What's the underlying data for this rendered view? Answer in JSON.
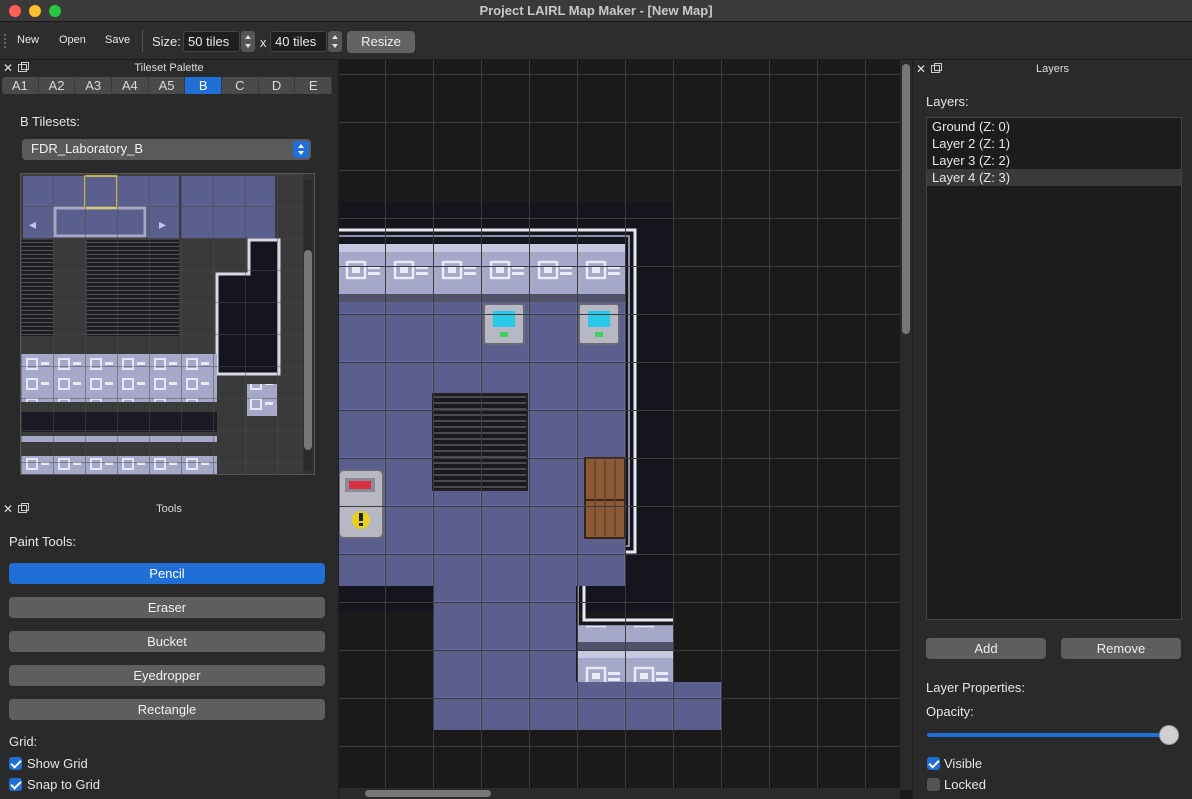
{
  "window": {
    "title": "Project LAIRL Map Maker - [New Map]"
  },
  "toolbar": {
    "new_label": "New",
    "open_label": "Open",
    "save_label": "Save",
    "size_label": "Size:",
    "width_value": "50 tiles",
    "x_label": "x",
    "height_value": "40 tiles",
    "resize_label": "Resize"
  },
  "tileset_palette": {
    "title": "Tileset Palette",
    "tabs": [
      {
        "label": "A1"
      },
      {
        "label": "A2"
      },
      {
        "label": "A3"
      },
      {
        "label": "A4"
      },
      {
        "label": "A5"
      },
      {
        "label": "B"
      },
      {
        "label": "C"
      },
      {
        "label": "D"
      },
      {
        "label": "E"
      }
    ],
    "active_tab": "B",
    "tilesets_label": "B Tilesets:",
    "selected_tileset": "FDR_Laboratory_B"
  },
  "tools": {
    "title": "Tools",
    "paint_label": "Paint Tools:",
    "buttons": [
      {
        "label": "Pencil"
      },
      {
        "label": "Eraser"
      },
      {
        "label": "Bucket"
      },
      {
        "label": "Eyedropper"
      },
      {
        "label": "Rectangle"
      }
    ],
    "active_tool": "Pencil",
    "grid_label": "Grid:",
    "show_grid_label": "Show Grid",
    "show_grid": true,
    "snap_label": "Snap to Grid",
    "snap": true
  },
  "layers": {
    "title": "Layers",
    "list_label": "Layers:",
    "items": [
      {
        "label": "Ground (Z: 0)"
      },
      {
        "label": "Layer 2 (Z: 1)"
      },
      {
        "label": "Layer 3 (Z: 2)"
      },
      {
        "label": "Layer 4 (Z: 3)"
      }
    ],
    "selected": "Layer 4 (Z: 3)",
    "add_label": "Add",
    "remove_label": "Remove",
    "properties_label": "Layer Properties:",
    "opacity_label": "Opacity:",
    "opacity": 1.0,
    "visible_label": "Visible",
    "visible": true,
    "locked_label": "Locked",
    "locked": false
  },
  "colors": {
    "accent": "#1f6fd6",
    "floor": "#5a5f8e",
    "wall": "#9da0c0",
    "void": "#1a1a26"
  }
}
